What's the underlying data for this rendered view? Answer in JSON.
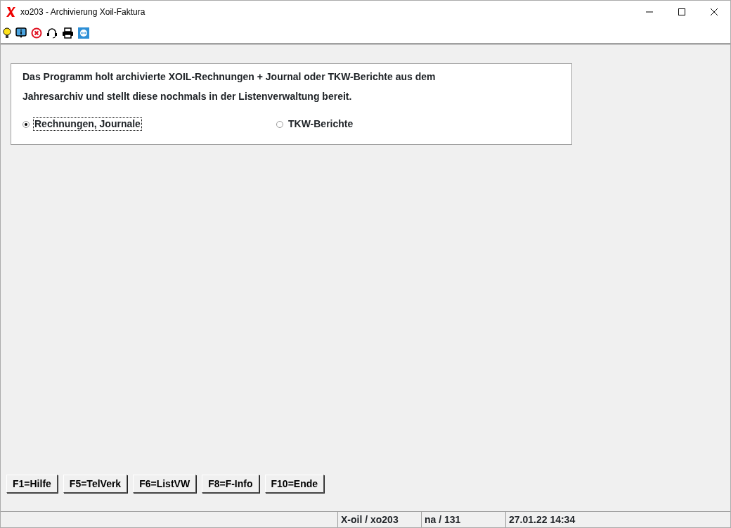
{
  "window": {
    "title": "xo203 - Archivierung Xoil-Faktura"
  },
  "description": "Das Programm holt archivierte XOIL-Rechnungen + Journal oder TKW-Berichte aus dem Jahresarchiv und stellt diese nochmals in der Listenverwaltung bereit.",
  "options": [
    {
      "label": "Rechnungen, Journale",
      "selected": true,
      "focused": true
    },
    {
      "label": "TKW-Berichte",
      "selected": false,
      "focused": false
    }
  ],
  "buttons": [
    "F1=Hilfe",
    "F5=TelVerk",
    "F6=ListVW",
    "F8=F-Info",
    "F10=Ende"
  ],
  "status_bar": [
    "X-oil / xo203",
    "na / 131",
    "27.01.22 14:34"
  ]
}
